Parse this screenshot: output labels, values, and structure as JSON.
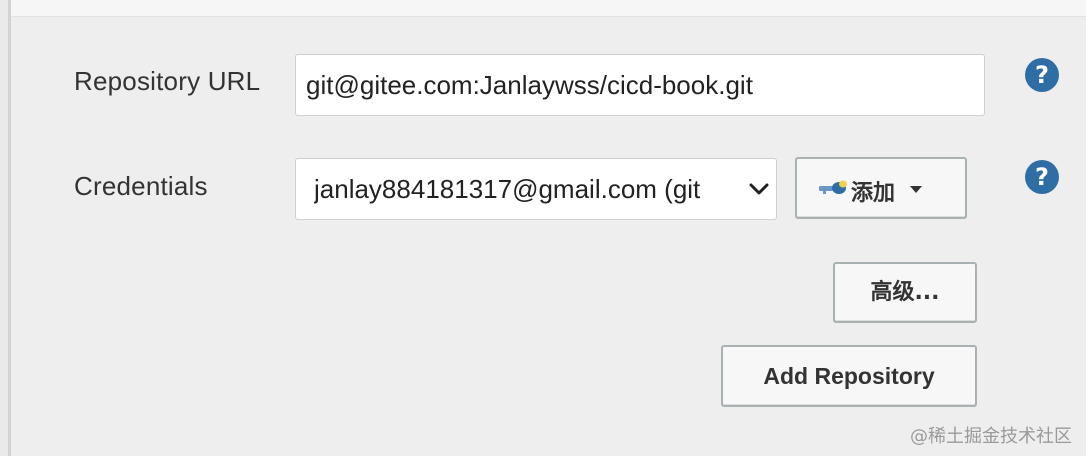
{
  "form": {
    "repository_url": {
      "label": "Repository URL",
      "value": "git@gitee.com:Janlaywss/cicd-book.git",
      "help": "?"
    },
    "credentials": {
      "label": "Credentials",
      "selected": "janlay884181317@gmail.com (git",
      "help": "?"
    }
  },
  "buttons": {
    "add": "添加",
    "advanced": "高级...",
    "add_repository": "Add Repository"
  },
  "watermark": "@稀土掘金技术社区",
  "colors": {
    "panel_bg": "#eeeeee",
    "help_icon": "#2f6ea5",
    "button_border": "#a9b2b2",
    "key_icon": "#2f6ea5"
  },
  "icons": {
    "help": "help-circle-icon",
    "credentials_dropdown": "chevron-down-icon",
    "add_dropdown": "caret-down-icon",
    "add_key": "key-icon"
  }
}
